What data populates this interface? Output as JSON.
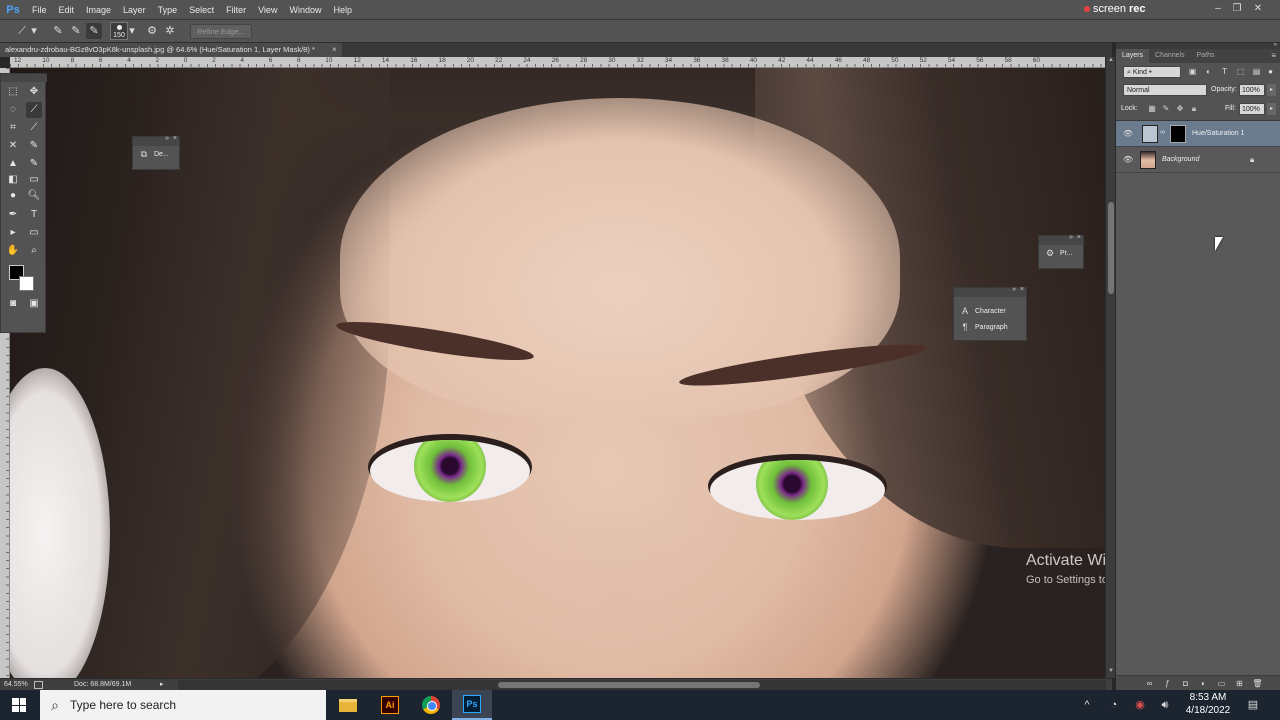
{
  "app": {
    "logo": "Ps"
  },
  "menu": [
    "File",
    "Edit",
    "Image",
    "Layer",
    "Type",
    "Select",
    "Filter",
    "View",
    "Window",
    "Help"
  ],
  "screenrec": {
    "prefix": "screen",
    "suffix": "rec"
  },
  "window_controls": {
    "minimize": "–",
    "restore": "❐",
    "close": "✕"
  },
  "options_bar": {
    "brush_size": "150",
    "refine_edge": "Refine Edge..."
  },
  "document": {
    "tab_title": "alexandru-zdrobau-BGz8vO3pK8k-unsplash.jpg @ 64.6% (Hue/Saturation 1, Layer Mask/8) *",
    "close": "×"
  },
  "ruler": {
    "top_labels": [
      "12",
      "10",
      "8",
      "6",
      "4",
      "2",
      "0",
      "2",
      "4",
      "6",
      "8",
      "10",
      "12",
      "14",
      "16",
      "18",
      "20",
      "22",
      "24",
      "26",
      "28",
      "30",
      "32",
      "34",
      "36",
      "38",
      "40",
      "42",
      "44",
      "46",
      "48",
      "50",
      "52",
      "54",
      "56",
      "58",
      "60"
    ]
  },
  "status": {
    "zoom": "64.55%",
    "doc": "Doc: 68.8M/69.1M",
    "arrow": "▸"
  },
  "mini_panels": {
    "device": {
      "label": "De..."
    },
    "properties": {
      "label": "Pr..."
    },
    "character": {
      "label": "Character"
    },
    "paragraph": {
      "label": "Paragraph"
    }
  },
  "layers_panel": {
    "tabs": [
      "Layers",
      "Channels",
      "Paths"
    ],
    "kind": "Kind",
    "blend_mode": "Normal",
    "opacity_label": "Opacity:",
    "opacity_value": "100%",
    "lock_label": "Lock:",
    "fill_label": "Fill:",
    "fill_value": "100%",
    "layers": [
      {
        "name": "Hue/Saturation 1",
        "selected": true
      },
      {
        "name": "Background",
        "selected": false
      }
    ]
  },
  "watermark": {
    "title": "Activate Windows",
    "subtitle": "Go to Settings to activate Windows."
  },
  "taskbar": {
    "search_placeholder": "Type here to search",
    "apps": [
      "file-explorer",
      "illustrator",
      "chrome",
      "photoshop"
    ],
    "ai_label": "Ai",
    "ps_label": "Ps",
    "time": "8:53 AM",
    "date": "4/18/2022"
  }
}
